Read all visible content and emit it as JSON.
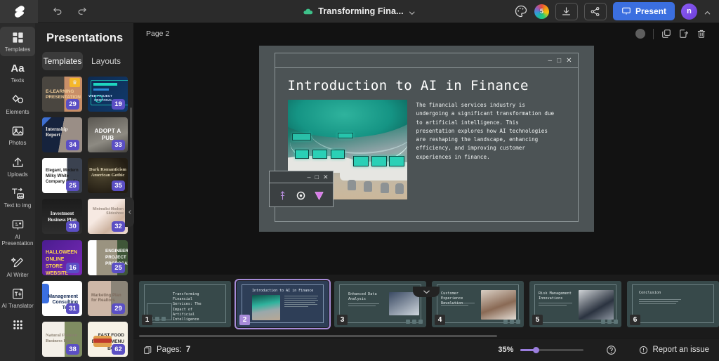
{
  "topbar": {
    "logo": "swirl-logo",
    "undo": "Undo",
    "redo": "Redo",
    "doc_title": "Transforming Fina...",
    "palette": "palette-icon",
    "color_count": "5",
    "download": "Download",
    "share": "Share",
    "present_label": "Present",
    "avatar_initial": "n"
  },
  "rail": {
    "items": [
      {
        "icon": "templates-icon",
        "label": "Templates",
        "active": true
      },
      {
        "icon": "texts-icon",
        "label": "Texts",
        "active": false
      },
      {
        "icon": "elements-icon",
        "label": "Elements",
        "active": false
      },
      {
        "icon": "photos-icon",
        "label": "Photos",
        "active": false
      },
      {
        "icon": "uploads-icon",
        "label": "Uploads",
        "active": false
      },
      {
        "icon": "text-to-img-icon",
        "label": "Text to img",
        "active": false
      },
      {
        "icon": "ai-presentation-icon",
        "label": "AI Presentation",
        "active": false
      },
      {
        "icon": "ai-writer-icon",
        "label": "AI Writer",
        "active": false
      },
      {
        "icon": "ai-translator-icon",
        "label": "AI Translator",
        "active": false
      },
      {
        "icon": "apps-grid-icon",
        "label": "",
        "active": false
      }
    ]
  },
  "panel": {
    "heading": "Presentations",
    "tabs": [
      {
        "label": "Templates",
        "active": true
      },
      {
        "label": "Layouts",
        "active": false
      }
    ],
    "templates": [
      {
        "title": "E-LEARNING PRESENTATION",
        "count": "29",
        "premium": true
      },
      {
        "title": "WEB PROJECT PROPOSAL",
        "count": "19",
        "premium": false
      },
      {
        "title": "Internship Report",
        "count": "34",
        "premium": false
      },
      {
        "title": "ADOPT A PUB",
        "count": "33",
        "premium": false
      },
      {
        "title": "Elegant, Modern Milky White Company Profile",
        "count": "25",
        "premium": false
      },
      {
        "title": "Dark Romanticism American Gothic",
        "count": "35",
        "premium": false
      },
      {
        "title": "Investment Business Plan",
        "count": "30",
        "premium": false
      },
      {
        "title": "Minimalist Modern Slideshow",
        "count": "32",
        "premium": false
      },
      {
        "title": "HALLOWEEN ONLINE STORE WEBSITE DESIGN",
        "count": "16",
        "premium": false
      },
      {
        "title": "ENGINEERING PROJECT PROPOSAL",
        "count": "25",
        "premium": false
      },
      {
        "title": "Management Consulting Toolkit",
        "count": "31",
        "premium": false
      },
      {
        "title": "Marketing Plan for Realtors",
        "count": "29",
        "premium": false
      },
      {
        "title": "Natural Fashion Business Plan",
        "count": "38",
        "premium": false
      },
      {
        "title": "FAST FOOD DIGITAL MENU BOARD",
        "count": "62",
        "premium": false
      }
    ],
    "collapse_handle": "chevron-left-icon"
  },
  "canvas": {
    "page_label": "Page 2",
    "tools": [
      "theme-dot",
      "duplicate-icon",
      "export-icon",
      "delete-icon"
    ],
    "window_controls": [
      "minimize",
      "maximize",
      "close"
    ],
    "slide": {
      "title": "Introduction to AI in Finance",
      "body": "The financial services industry is\nundergoing a significant transformation due\nto artificial intelligence. This\npresentation explores how AI technologies\nare reshaping the landscape, enhancing\nefficiency, and improving customer\nexperiences in finance.",
      "image_alt": "futuristic teal control room"
    },
    "float_panel": {
      "window_controls": [
        "minimize",
        "maximize",
        "close"
      ],
      "icons": [
        "vertical-arrow-icon",
        "target-icon",
        "triangle-down-icon"
      ]
    },
    "collapse_chevron": "chevron-down-icon"
  },
  "filmstrip": {
    "slides": [
      {
        "num": "1",
        "title": "Transforming\nFinancial Services:\nThe Impact of\nArtificial\nIntelligence",
        "selected": false
      },
      {
        "num": "2",
        "title": "Introduction to AI in Finance",
        "selected": true
      },
      {
        "num": "3",
        "title": "Enhanced Data\nAnalysis",
        "selected": false
      },
      {
        "num": "4",
        "title": "Customer Experience\nRevolution",
        "selected": false
      },
      {
        "num": "5",
        "title": "Risk Management\nInnovations",
        "selected": false
      },
      {
        "num": "6",
        "title": "Conclusion",
        "selected": false
      }
    ]
  },
  "status": {
    "pages_label": "Pages:",
    "pages_count": "7",
    "zoom": "35%",
    "help": "help-icon",
    "report_label": "Report an issue"
  },
  "colors": {
    "accent_blue": "#3b6fe0",
    "accent_purple": "#9b7ede",
    "badge_purple": "#5b4fc4",
    "slide_bg": "#4c5355",
    "app_bg": "#1e1e1e"
  }
}
